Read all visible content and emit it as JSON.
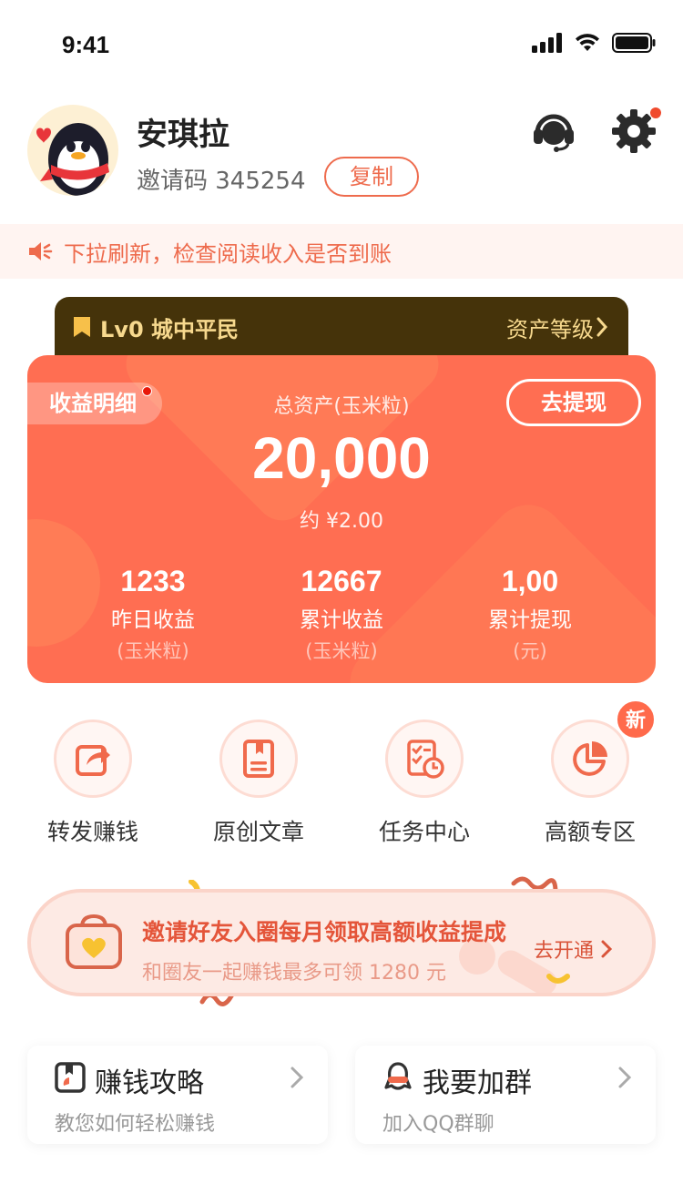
{
  "status_bar": {
    "time": "9:41"
  },
  "profile": {
    "name": "安琪拉",
    "invite_code": "邀请码 345254",
    "copy_label": "复制"
  },
  "notice": {
    "text": "下拉刷新，检查阅读收入是否到账"
  },
  "level": {
    "label": "Lv0 城中平民",
    "link": "资产等级"
  },
  "assets": {
    "detail_tab": "收益明细",
    "withdraw_button": "去提现",
    "total_label": "总资产(玉米粒)",
    "total_value": "20,000",
    "total_approx": "约 ¥2.00",
    "stats": [
      {
        "value": "1233",
        "label": "昨日收益",
        "unit": "(玉米粒)"
      },
      {
        "value": "12667",
        "label": "累计收益",
        "unit": "(玉米粒)"
      },
      {
        "value": "1,00",
        "label": "累计提现",
        "unit": "(元)"
      }
    ]
  },
  "features": [
    {
      "label": "转发赚钱",
      "icon": "share-icon"
    },
    {
      "label": "原创文章",
      "icon": "article-icon"
    },
    {
      "label": "任务中心",
      "icon": "task-icon"
    },
    {
      "label": "高额专区",
      "icon": "pie-chart-icon"
    }
  ],
  "new_badge": "新",
  "banner": {
    "title": "邀请好友入圈每月领取高额收益提成",
    "subtitle": "和圈友一起赚钱最多可领 1280 元",
    "action": "去开通"
  },
  "cards": [
    {
      "title": "赚钱攻略",
      "subtitle": "教您如何轻松赚钱",
      "icon": "guide-book-icon"
    },
    {
      "title": "我要加群",
      "subtitle": "加入QQ群聊",
      "icon": "qq-penguin-icon"
    }
  ],
  "colors": {
    "accent": "#ff6e52",
    "level_bg": "#45330a",
    "level_text": "#f7d98e"
  }
}
